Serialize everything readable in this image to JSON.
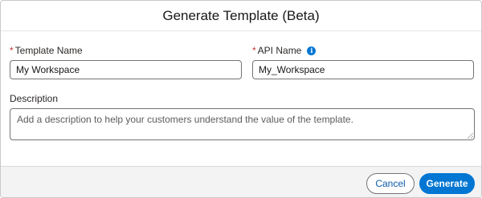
{
  "modal": {
    "title": "Generate Template (Beta)"
  },
  "form": {
    "template_name": {
      "label": "Template Name",
      "required_mark": "*",
      "value": "My Workspace"
    },
    "api_name": {
      "label": "API Name",
      "required_mark": "*",
      "value": "My_Workspace",
      "info_icon": "i"
    },
    "description": {
      "label": "Description",
      "placeholder": "Add a description to help your customers understand the value of the template."
    }
  },
  "footer": {
    "cancel_label": "Cancel",
    "generate_label": "Generate"
  },
  "colors": {
    "brand": "#0176d3",
    "required": "#c23934",
    "footer_bg": "#f3f3f3"
  }
}
